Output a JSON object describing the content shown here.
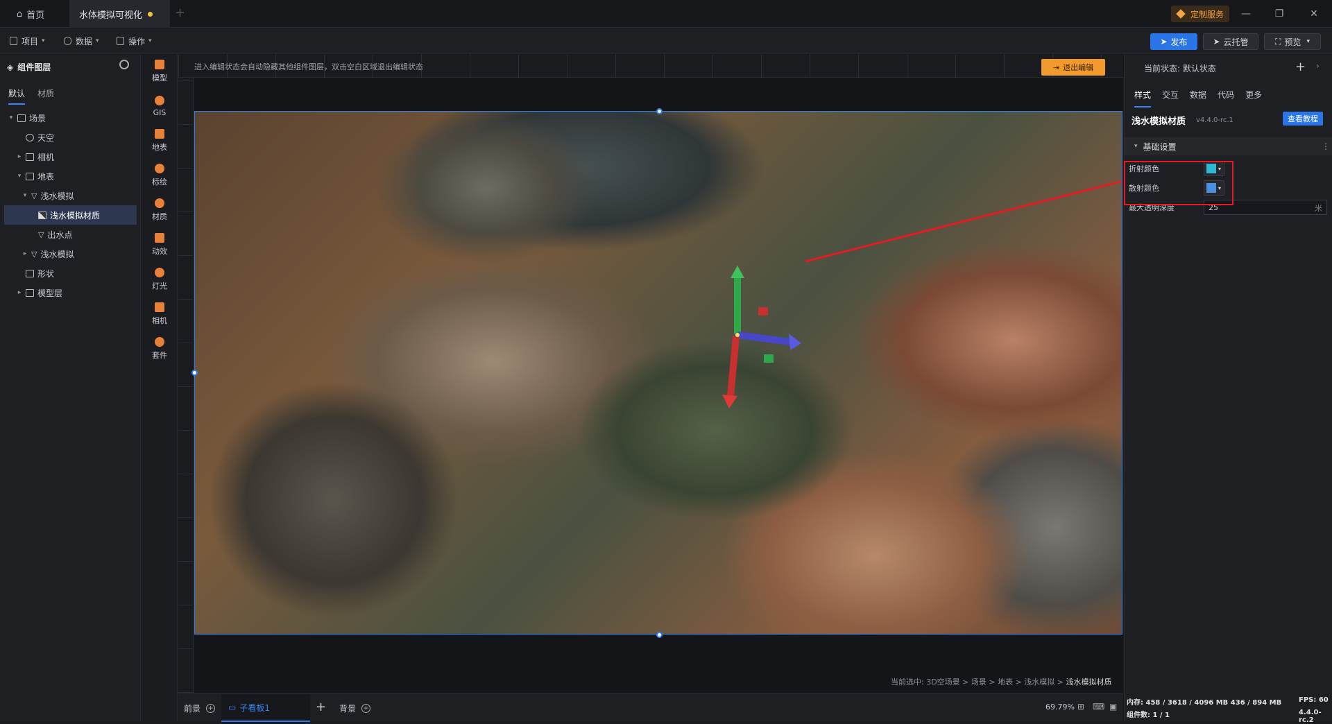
{
  "titlebar": {
    "home_tab": "首页",
    "doc_tab": "水体模拟可视化",
    "custom_service": "定制服务"
  },
  "menubar": {
    "project": "项目",
    "data": "数据",
    "operate": "操作",
    "publish": "发布",
    "cloud": "云托管",
    "preview": "预览"
  },
  "left_panel": {
    "title": "组件图层",
    "tabs": [
      "默认",
      "材质"
    ],
    "tree": [
      {
        "label": "场景",
        "depth": 0,
        "expanded": true
      },
      {
        "label": "天空",
        "depth": 1
      },
      {
        "label": "相机",
        "depth": 1,
        "expandable": true
      },
      {
        "label": "地表",
        "depth": 1,
        "expanded": true
      },
      {
        "label": "浅水模拟",
        "depth": 2,
        "expanded": true
      },
      {
        "label": "浅水模拟材质",
        "depth": 3,
        "selected": true
      },
      {
        "label": "出水点",
        "depth": 3
      },
      {
        "label": "浅水模拟",
        "depth": 2,
        "expandable": true
      },
      {
        "label": "形状",
        "depth": 1
      },
      {
        "label": "模型层",
        "depth": 1,
        "expandable": true
      }
    ]
  },
  "tools": [
    "模型",
    "GIS",
    "地表",
    "标绘",
    "材质",
    "动效",
    "灯光",
    "相机",
    "套件"
  ],
  "canvas": {
    "hint": "进入编辑状态会自动隐藏其他组件图层，双击空白区域退出编辑状态",
    "exit_edit": "退出编辑",
    "breadcrumb_prefix": "当前选中: 3D空场景 > 场景 > 地表 > 浅水模拟 > ",
    "breadcrumb_current": "浅水模拟材质"
  },
  "bottombar": {
    "front": "前景",
    "sub_panel": "子看板1",
    "background": "背景",
    "zoom": "69.79%"
  },
  "right_panel": {
    "state": "当前状态:  默认状态",
    "tabs": [
      "样式",
      "交互",
      "数据",
      "代码",
      "更多"
    ],
    "component_title": "浅水模拟材质",
    "version": "v4.4.0-rc.1",
    "tutorial": "查看教程",
    "section": "基础设置",
    "props": {
      "refraction_label": "折射颜色",
      "refraction_color": "#2fb8d6",
      "scatter_label": "散射颜色",
      "scatter_color": "#4a8fe0",
      "depth_label": "最大透明深度",
      "depth_value": "25",
      "depth_unit": "米"
    }
  },
  "status": {
    "memory": "内存:  458 / 3618 / 4096 MB  436 / 894 MB",
    "fps": "FPS:  60",
    "components": "组件数: 1 / 1",
    "version": "4.4.0-rc.2"
  }
}
